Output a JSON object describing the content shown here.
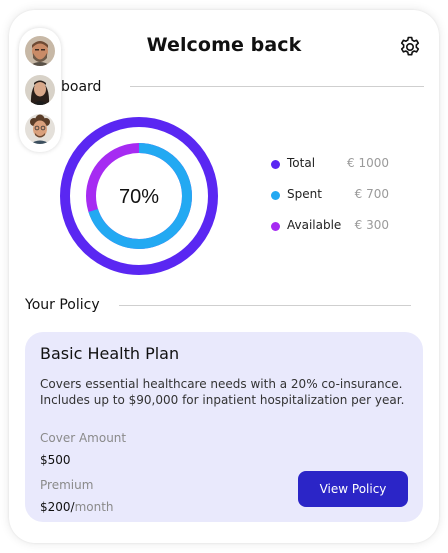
{
  "header": {
    "title": "Welcome back",
    "settings_icon": "gear-icon"
  },
  "avatars": [
    "avatar-man-beard",
    "avatar-woman",
    "avatar-man-curly"
  ],
  "dashboard": {
    "section_label": "board",
    "center_label": "70%",
    "spent_fraction": 0.7,
    "colors": {
      "total": "#5a27f2",
      "spent": "#23a9f2",
      "available": "#a62bf2"
    },
    "legend": [
      {
        "name": "Total",
        "value": "€ 1000"
      },
      {
        "name": "Spent",
        "value": "€ 700"
      },
      {
        "name": "Available",
        "value": "€ 300"
      }
    ]
  },
  "policy": {
    "section_label": "Your Policy",
    "plan_name": "Basic Health Plan",
    "description": "Covers essential healthcare needs with a  20% co-insurance. Includes up to $90,000 for inpatient hospitalization per year.",
    "cover_label": "Cover Amount",
    "cover_value": "$500",
    "premium_label": "Premium",
    "premium_value": "$200/",
    "premium_period": "month",
    "button_label": "View Policy"
  }
}
